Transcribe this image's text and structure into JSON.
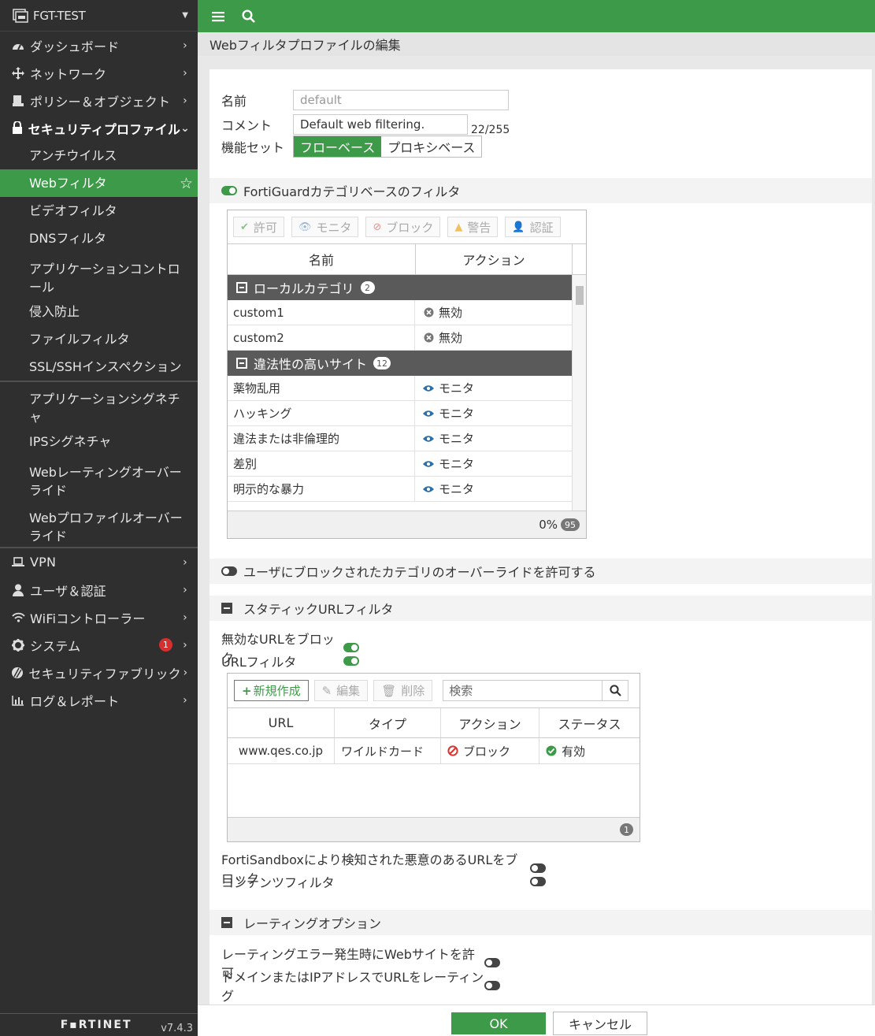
{
  "sidebar": {
    "device": "FGT-TEST",
    "menu": [
      {
        "label": "ダッシュボード"
      },
      {
        "label": "ネットワーク"
      },
      {
        "label": "ポリシー＆オブジェクト"
      },
      {
        "label": "セキュリティプロファイル"
      }
    ],
    "sub": [
      "アンチウイルス",
      "Webフィルタ",
      "ビデオフィルタ",
      "DNSフィルタ",
      "アプリケーションコントロール",
      "侵入防止",
      "ファイルフィルタ",
      "SSL/SSHインスペクション",
      "アプリケーションシグネチャ",
      "IPSシグネチャ",
      "Webレーティングオーバーライド",
      "Webプロファイルオーバーライド"
    ],
    "menu2": [
      {
        "label": "VPN"
      },
      {
        "label": "ユーザ＆認証"
      },
      {
        "label": "WiFiコントローラー"
      },
      {
        "label": "システム",
        "badge": "1"
      },
      {
        "label": "セキュリティファブリック"
      },
      {
        "label": "ログ＆レポート"
      }
    ],
    "logo": "F▪RTINET",
    "version": "v7.4.3"
  },
  "page_title": "Webフィルタプロファイルの編集",
  "form": {
    "name_label": "名前",
    "name_placeholder": "default",
    "comment_label": "コメント",
    "comment_value": "Default web filtering.",
    "comment_count": "22/255",
    "feature_label": "機能セット",
    "feature_flow": "フローベース",
    "feature_proxy": "プロキシベース"
  },
  "fortiguard": {
    "section_label": "FortiGuardカテゴリベースのフィルタ",
    "buttons": [
      "許可",
      "モニタ",
      "ブロック",
      "警告",
      "認証"
    ],
    "col_name": "名前",
    "col_action": "アクション",
    "groups": [
      {
        "label": "ローカルカテゴリ",
        "count": "2",
        "rows": [
          {
            "name": "custom1",
            "action": "無効"
          },
          {
            "name": "custom2",
            "action": "無効"
          }
        ]
      },
      {
        "label": "違法性の高いサイト",
        "count": "12",
        "rows": [
          {
            "name": "薬物乱用",
            "action": "モニタ"
          },
          {
            "name": "ハッキング",
            "action": "モニタ"
          },
          {
            "name": "違法または非倫理的",
            "action": "モニタ"
          },
          {
            "name": "差別",
            "action": "モニタ"
          },
          {
            "name": "明示的な暴力",
            "action": "モニタ"
          }
        ]
      }
    ],
    "footer_percent": "0%",
    "footer_total": "95"
  },
  "override_label": "ユーザにブロックされたカテゴリのオーバーライドを許可する",
  "static_url": {
    "section_label": "スタティックURLフィルタ",
    "block_invalid_label": "無効なURLをブロック",
    "url_filter_label": "URLフィルタ",
    "new_btn": "新規作成",
    "edit_btn": "編集",
    "delete_btn": "削除",
    "search_placeholder": "検索",
    "columns": [
      "URL",
      "タイプ",
      "アクション",
      "ステータス"
    ],
    "rows": [
      {
        "url": "www.qes.co.jp",
        "type": "ワイルドカード",
        "action": "ブロック",
        "status": "有効"
      }
    ],
    "count": "1",
    "sandbox_label": "FortiSandboxにより検知された悪意のあるURLをブロック",
    "content_filter_label": "コンテンツフィルタ"
  },
  "rating": {
    "section_label": "レーティングオプション",
    "allow_on_error": "レーティングエラー発生時にWebサイトを許可",
    "rate_by_domain_ip": "ドメインまたはIPアドレスでURLをレーティング"
  },
  "actions": {
    "ok": "OK",
    "cancel": "キャンセル"
  },
  "colors": {
    "accent": "#3d9a48",
    "sidebar": "#2f2f2f"
  }
}
